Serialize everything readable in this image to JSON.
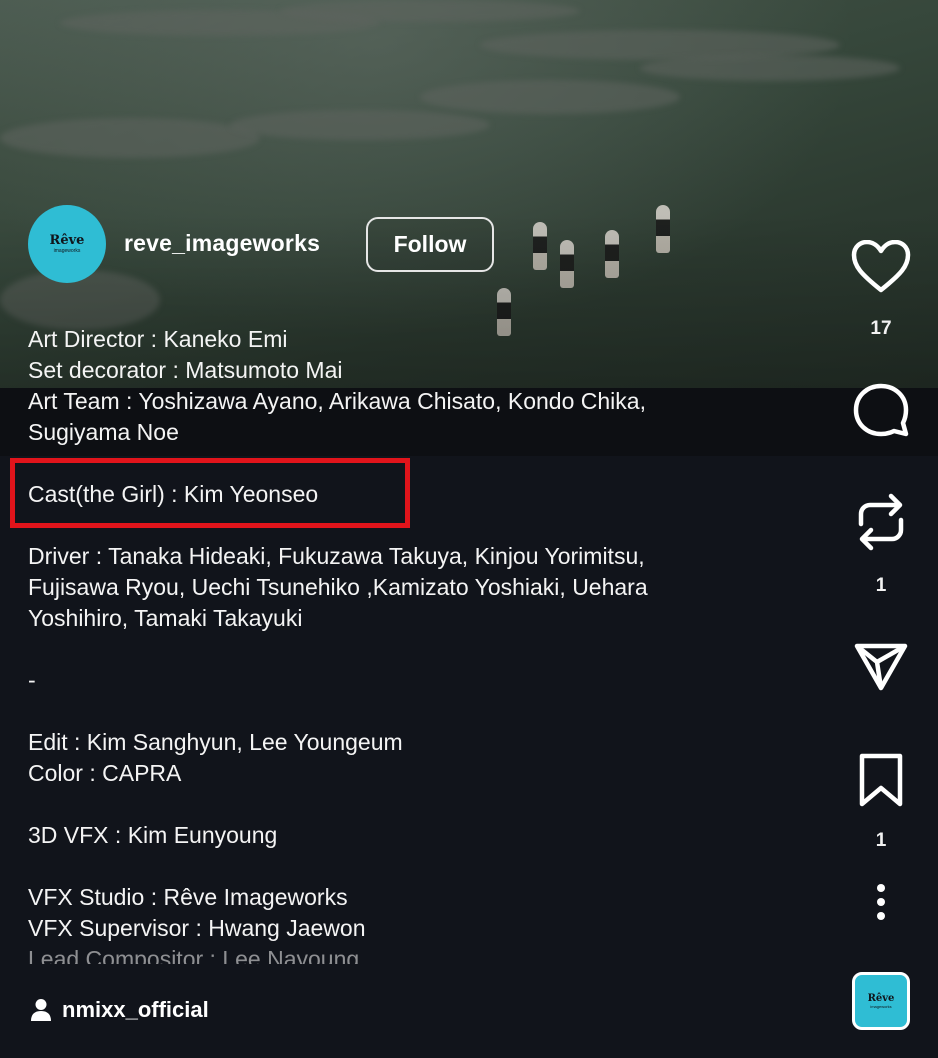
{
  "post": {
    "username": "reve_imageworks",
    "follow_label": "Follow",
    "avatar_logo": "Rêve",
    "avatar_logo_sub": "imageworks"
  },
  "caption": {
    "lines": [
      "Art Director : Kaneko Emi",
      "Set decorator : Matsumoto Mai",
      "Art Team : Yoshizawa Ayano, Arikawa Chisato, Kondo Chika,",
      "Sugiyama Noe",
      "",
      "Cast(the Girl) : Kim Yeonseo",
      "",
      "Driver : Tanaka Hideaki, Fukuzawa Takuya, Kinjou Yorimitsu,",
      "Fujisawa Ryou, Uechi Tsunehiko ,Kamizato Yoshiaki, Uehara",
      "Yoshihiro, Tamaki Takayuki",
      "",
      "-",
      "",
      "Edit : Kim Sanghyun, Lee Youngeum",
      "Color : CAPRA",
      "",
      "3D VFX : Kim Eunyoung",
      "",
      "VFX Studio : Rêve Imageworks",
      "VFX Supervisor : Hwang Jaewon",
      "Lead Compositor : Lee Nayoung"
    ]
  },
  "actions": {
    "like_count": "17",
    "repost_count": "1",
    "save_count": "1"
  },
  "footer": {
    "tagged_user": "nmixx_official",
    "audio_logo": "Rêve",
    "audio_logo_sub": "imageworks"
  },
  "colors": {
    "highlight": "#e0141b",
    "avatar_bg": "#2fbdd4",
    "background": "#11141b"
  }
}
